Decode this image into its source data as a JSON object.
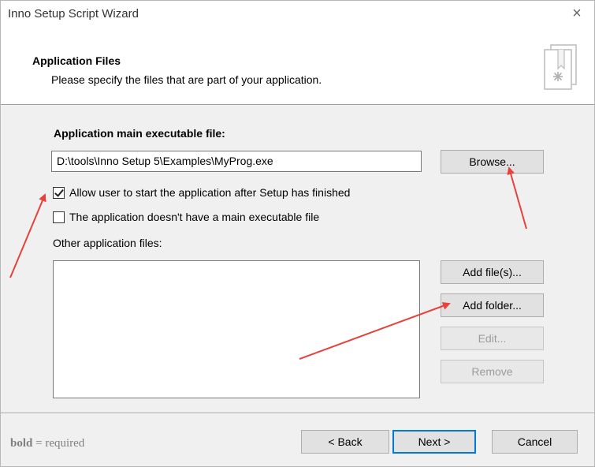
{
  "window": {
    "title": "Inno Setup Script Wizard",
    "close_glyph": "×"
  },
  "header": {
    "title": "Application Files",
    "subtitle": "Please specify the files that are part of your application."
  },
  "main_exe": {
    "label": "Application main executable file:",
    "value": "D:\\tools\\Inno Setup 5\\Examples\\MyProg.exe",
    "browse_label": "Browse..."
  },
  "options": {
    "allow_start": {
      "label": "Allow user to start the application after Setup has finished",
      "checked": true
    },
    "no_main_exe": {
      "label": "The application doesn't have a main executable file",
      "checked": false
    }
  },
  "other_files": {
    "label": "Other application files:",
    "items": [],
    "add_files_label": "Add file(s)...",
    "add_folder_label": "Add folder...",
    "edit_label": "Edit...",
    "remove_label": "Remove"
  },
  "footer": {
    "hint_bold": "bold",
    "hint_rest": " = required",
    "back_label": "< Back",
    "next_label": "Next >",
    "cancel_label": "Cancel"
  },
  "annotation_color": "#e8403a"
}
